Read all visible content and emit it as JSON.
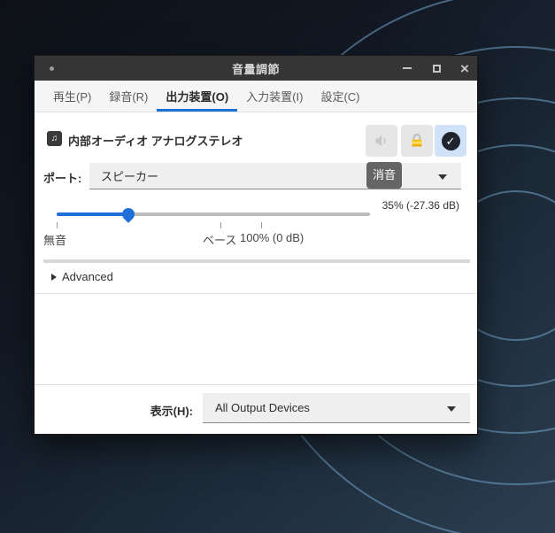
{
  "titlebar": {
    "title": "音量調節"
  },
  "tabs": [
    {
      "label": "再生(P)",
      "active": false
    },
    {
      "label": "録音(R)",
      "active": false
    },
    {
      "label": "出力装置(O)",
      "active": true
    },
    {
      "label": "入力装置(I)",
      "active": false
    },
    {
      "label": "設定(C)",
      "active": false
    }
  ],
  "device": {
    "name": "内部オーディオ アナログステレオ",
    "icon": "musical-notes",
    "note_glyph": "♫",
    "check_glyph": "✓"
  },
  "tooltip": {
    "text": "消音"
  },
  "port": {
    "label": "ポート:",
    "value": "スピーカー"
  },
  "volume": {
    "value_label": "35% (-27.36 dB)",
    "percent": 35,
    "max_percent": 153,
    "marks": [
      {
        "label": "無音",
        "pct": 0
      },
      {
        "label": "ベース",
        "pct": 52.3
      },
      {
        "label": "100% (0 dB)",
        "pct": 65.3
      }
    ]
  },
  "advanced": {
    "label": "Advanced"
  },
  "footer": {
    "label": "表示(H):",
    "value": "All Output Devices"
  },
  "colors": {
    "accent_blue": "#1f6fd9",
    "titlebar_bg": "#353535",
    "tooltip_bg": "#656565",
    "check_button_bg": "#cfe2f7",
    "lock_yellow": "#f5c211",
    "desktop_navy": "#1e2d3c",
    "arc_blue": "#74a6cc"
  }
}
